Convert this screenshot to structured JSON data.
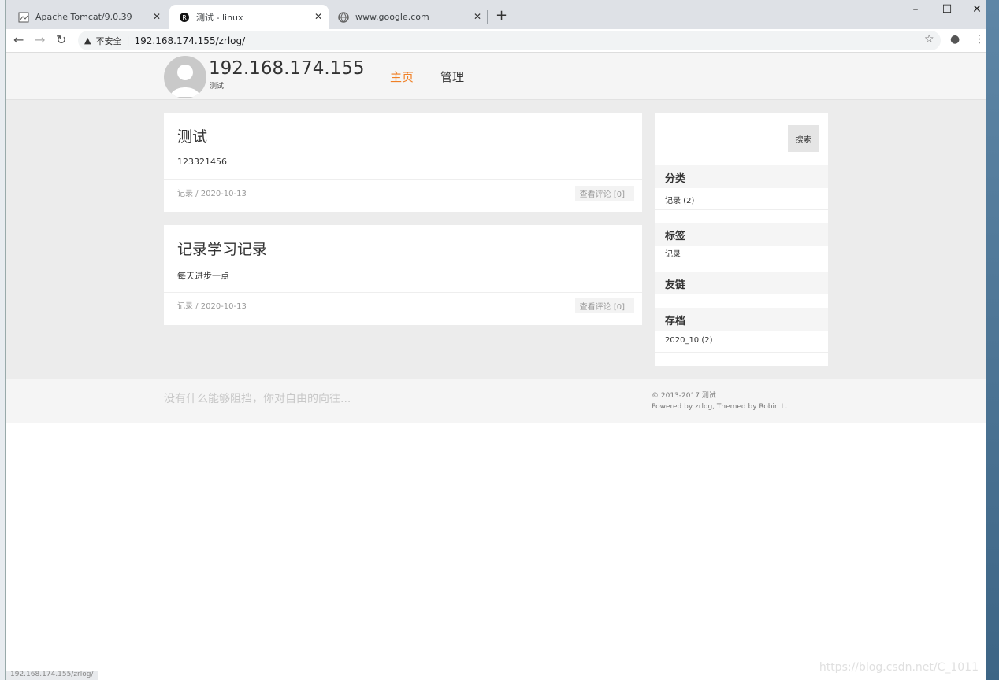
{
  "tabs": [
    {
      "title": "Apache Tomcat/9.0.39"
    },
    {
      "title": "测试 - linux"
    },
    {
      "title": "www.google.com"
    }
  ],
  "address": {
    "security_label": "不安全",
    "url": "192.168.174.155/zrlog/"
  },
  "site": {
    "title": "192.168.174.155",
    "subtitle": "测试",
    "nav": [
      "主页",
      "管理"
    ]
  },
  "posts": [
    {
      "title": "测试",
      "body": "123321456",
      "meta": "记录 / 2020-10-13",
      "comments": "查看评论 [0]"
    },
    {
      "title": "记录学习记录",
      "body": "每天进步一点",
      "meta": "记录 / 2020-10-13",
      "comments": "查看评论 [0]"
    }
  ],
  "sidebar": {
    "search_button": "搜索",
    "categories_title": "分类",
    "categories": [
      "记录 (2)"
    ],
    "tags_title": "标签",
    "tags": [
      "记录"
    ],
    "links_title": "友链",
    "archive_title": "存档",
    "archives": [
      "2020_10 (2)"
    ]
  },
  "footer": {
    "slogan": "没有什么能够阻挡，你对自由的向往...",
    "copyright": "© 2013-2017 测试",
    "powered": "Powered by zrlog, Themed by Robin L."
  },
  "status_url": "192.168.174.155/zrlog/",
  "watermark": "https://blog.csdn.net/C_1011",
  "colors": {
    "accent": "#f08026"
  }
}
